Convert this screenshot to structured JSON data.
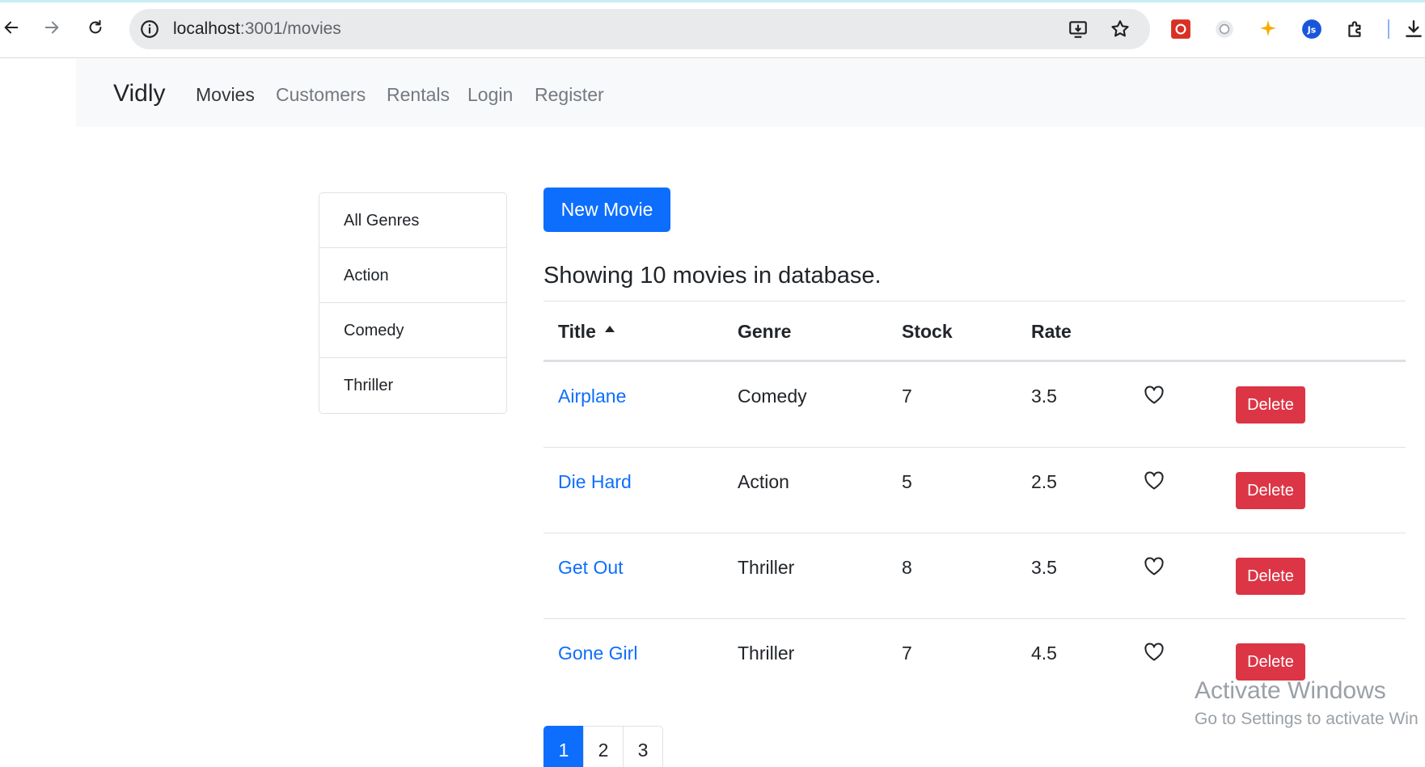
{
  "browser": {
    "url_host": "localhost",
    "url_path": ":3001/movies"
  },
  "navbar": {
    "brand": "Vidly",
    "links": [
      "Movies",
      "Customers",
      "Rentals",
      "Login",
      "Register"
    ]
  },
  "genres": [
    "All Genres",
    "Action",
    "Comedy",
    "Thriller"
  ],
  "main": {
    "new_movie_label": "New Movie",
    "count_text": "Showing 10 movies in database.",
    "columns": [
      "Title",
      "Genre",
      "Stock",
      "Rate"
    ],
    "rows": [
      {
        "title": "Airplane",
        "genre": "Comedy",
        "stock": "7",
        "rate": "3.5",
        "delete_label": "Delete"
      },
      {
        "title": "Die Hard",
        "genre": "Action",
        "stock": "5",
        "rate": "2.5",
        "delete_label": "Delete"
      },
      {
        "title": "Get Out",
        "genre": "Thriller",
        "stock": "8",
        "rate": "3.5",
        "delete_label": "Delete"
      },
      {
        "title": "Gone Girl",
        "genre": "Thriller",
        "stock": "7",
        "rate": "4.5",
        "delete_label": "Delete"
      }
    ],
    "pages": [
      "1",
      "2",
      "3"
    ],
    "active_page": "1"
  },
  "watermark": {
    "line1": "Activate Windows",
    "line2": "Go to Settings to activate Win"
  },
  "colors": {
    "primary": "#0d6efd",
    "danger": "#dc3545",
    "navbar_bg": "#f8f9fa"
  },
  "icons": [
    "back-arrow-icon",
    "forward-arrow-icon",
    "reload-icon",
    "site-info-icon",
    "install-app-icon",
    "bookmark-star-icon",
    "extension-icons",
    "heart-icon",
    "sort-asc-icon"
  ]
}
